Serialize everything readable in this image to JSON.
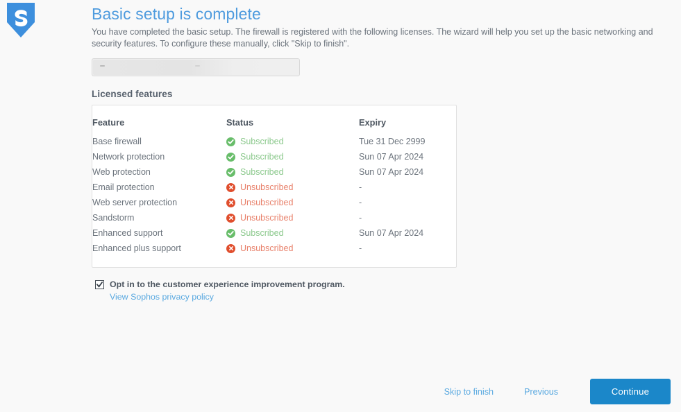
{
  "brand": {
    "logo_icon": "sophos-shield-icon",
    "logo_color": "#3d8fdd"
  },
  "page": {
    "title": "Basic setup is complete",
    "subtitle": "You have completed the basic setup. The firewall is registered with the following licenses. The wizard will help you set up the basic networking and security features. To configure these manually, click \"Skip to finish\".",
    "title_color": "#4e9bde"
  },
  "redacted_field": {
    "value": "",
    "placeholder": ""
  },
  "licensed_features": {
    "section_title": "Licensed features",
    "columns": [
      "Feature",
      "Status",
      "Expiry"
    ],
    "status_labels": {
      "subscribed": "Subscribed",
      "unsubscribed": "Unsubscribed"
    },
    "status_colors": {
      "subscribed": "#68bd6a",
      "unsubscribed": "#e04e2d"
    },
    "rows": [
      {
        "feature": "Base firewall",
        "status": "Subscribed",
        "status_icon": "check-circle-icon",
        "expiry": "Tue 31 Dec 2999"
      },
      {
        "feature": "Network protection",
        "status": "Subscribed",
        "status_icon": "check-circle-icon",
        "expiry": "Sun 07 Apr 2024"
      },
      {
        "feature": "Web protection",
        "status": "Subscribed",
        "status_icon": "check-circle-icon",
        "expiry": "Sun 07 Apr 2024"
      },
      {
        "feature": "Email protection",
        "status": "Unsubscribed",
        "status_icon": "x-circle-icon",
        "expiry": "-"
      },
      {
        "feature": "Web server protection",
        "status": "Unsubscribed",
        "status_icon": "x-circle-icon",
        "expiry": "-"
      },
      {
        "feature": "Sandstorm",
        "status": "Unsubscribed",
        "status_icon": "x-circle-icon",
        "expiry": "-"
      },
      {
        "feature": "Enhanced support",
        "status": "Subscribed",
        "status_icon": "check-circle-icon",
        "expiry": "Sun 07 Apr 2024"
      },
      {
        "feature": "Enhanced plus support",
        "status": "Unsubscribed",
        "status_icon": "x-circle-icon",
        "expiry": "-"
      }
    ]
  },
  "optin": {
    "checked": true,
    "label": "Opt in to the customer experience improvement program.",
    "link_text": "View Sophos privacy policy",
    "link_color": "#5aa9e0"
  },
  "footer": {
    "skip_label": "Skip to finish",
    "previous_label": "Previous",
    "continue_label": "Continue",
    "continue_color": "#1b87c9"
  }
}
